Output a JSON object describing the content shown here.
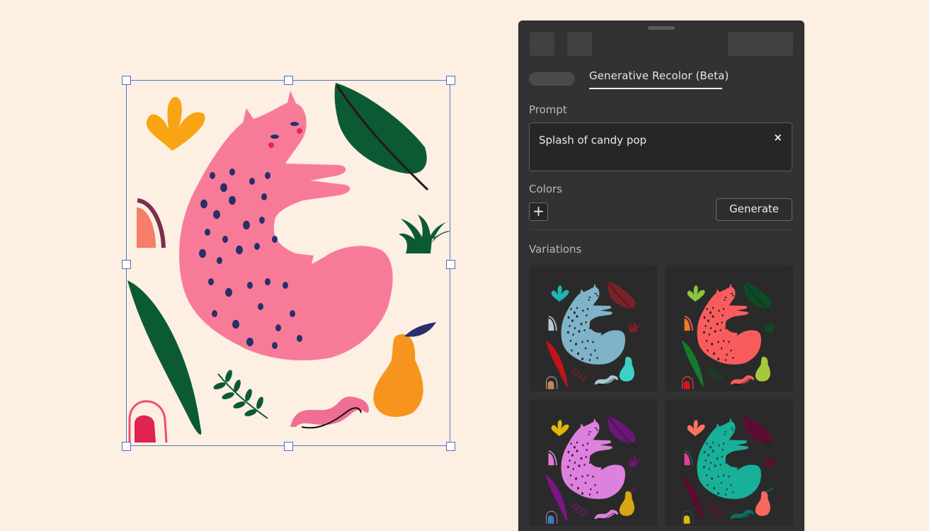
{
  "canvas": {
    "background": "#fdefe2",
    "selection_color": "#4f6fbf",
    "artwork": {
      "name": "Pink cat with tropical plants",
      "palette": {
        "cat": "#f77b99",
        "spots": "#26306b",
        "cheeks": "#e8244f",
        "flower": "#f8a413",
        "big_leaf": "#0b5a34",
        "long_leaf": "#0b5a34",
        "grass": "#0b5a34",
        "sprig": "#0b5a34",
        "arch_fill": "#f57d69",
        "arch_stroke": "#7c2f4d",
        "bottom_arch_fill": "#e0234f",
        "bottom_arch_stroke": "#ee4f71",
        "pear": "#f7941d",
        "pear_leaf": "#26306b",
        "wave": "#ee6f93",
        "wave_line": "#111111",
        "wave_dots": "#f2b43a"
      }
    }
  },
  "panel": {
    "tab_title": "Generative Recolor (Beta)",
    "prompt_label": "Prompt",
    "prompt_value": "Splash of candy pop",
    "clear_icon": "×",
    "colors_label": "Colors",
    "add_color_icon": "+",
    "generate_label": "Generate",
    "variations_label": "Variations",
    "variations": [
      {
        "cat": "#7fb3c9",
        "spots": "#2a2a2a",
        "flower": "#1fb5b0",
        "leaf": "#7a2128",
        "long_leaf": "#c2121a",
        "grass": "#7a2128",
        "arch": "#c98456",
        "arch_stroke": "#c7b5b5",
        "small_arch": "#b4cad8",
        "pear": "#3dd1c6",
        "wave": "#a8c7d4",
        "sprig": "#6a2128"
      },
      {
        "cat": "#fa5c5e",
        "spots": "#2a2a2a",
        "flower": "#8bc53f",
        "leaf": "#0d4b26",
        "long_leaf": "#157a2a",
        "grass": "#0d4b26",
        "arch": "#e1101b",
        "arch_stroke": "#f05a5a",
        "small_arch": "#f07a1c",
        "pear": "#a8c83b",
        "wave": "#fa5c5e",
        "sprig": "#0d4b26"
      },
      {
        "cat": "#dd82dc",
        "spots": "#5a1460",
        "flower": "#e1b70f",
        "leaf": "#6b1775",
        "long_leaf": "#7c1585",
        "grass": "#6b1775",
        "arch": "#3d7fb0",
        "arch_stroke": "#c380d0",
        "small_arch": "#e27ad8",
        "pear": "#d9a514",
        "wave": "#dd82dc",
        "sprig": "#6b1775"
      },
      {
        "cat": "#19b09a",
        "spots": "#1e4d48",
        "flower": "#f9745f",
        "leaf": "#5d0d34",
        "long_leaf": "#5a0d30",
        "grass": "#5d0d34",
        "arch": "#e1b70f",
        "arch_stroke": "#1c5a52",
        "small_arch": "#e23f9c",
        "pear": "#f9685f",
        "wave": "#0f6f65",
        "sprig": "#5d0d34"
      }
    ]
  }
}
